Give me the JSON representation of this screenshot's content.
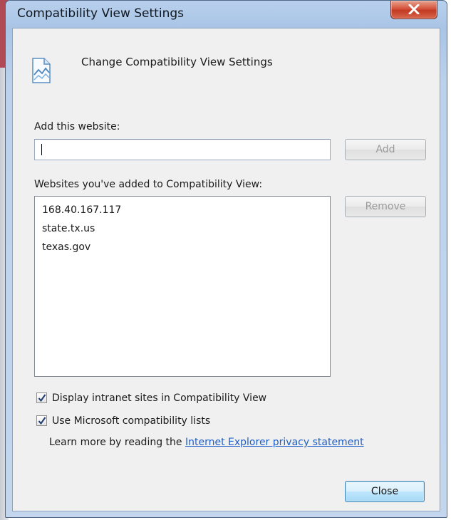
{
  "window": {
    "title": "Compatibility View Settings"
  },
  "header": {
    "text": "Change Compatibility View Settings",
    "icon": "compatibility-view-icon"
  },
  "add_site": {
    "label": "Add this website:",
    "input_value": "",
    "button_label": "Add",
    "button_enabled": false
  },
  "sites": {
    "label": "Websites you've added to Compatibility View:",
    "items": [
      "168.40.167.117",
      "state.tx.us",
      "texas.gov"
    ],
    "remove_label": "Remove",
    "remove_enabled": false
  },
  "options": {
    "intranet": {
      "label": "Display intranet sites in Compatibility View",
      "checked": true
    },
    "ms_lists": {
      "label": "Use Microsoft compatibility lists",
      "checked": true
    }
  },
  "learn_more": {
    "prefix": "Learn more by reading the",
    "link": "Internet Explorer privacy statement"
  },
  "footer": {
    "close_label": "Close"
  },
  "colors": {
    "link": "#1f5fc7",
    "close_button": "#c23a22",
    "window_frame": "#a9c4e6"
  }
}
